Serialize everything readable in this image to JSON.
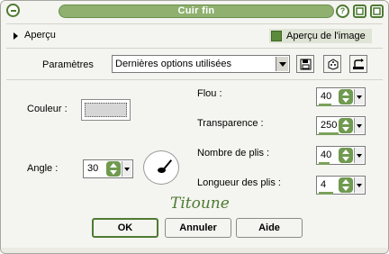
{
  "window": {
    "title": "Cuir fin",
    "help_glyph": "?"
  },
  "preview": {
    "toggle_label": "Aperçu",
    "image_checkbox_label": "Aperçu de l'image",
    "image_checked": true
  },
  "params": {
    "label": "Paramètres",
    "selected": "Dernières options utilisées"
  },
  "fields": {
    "couleur_label": "Couleur :",
    "couleur_value": "#d6d6d6",
    "angle_label": "Angle :",
    "angle_value": "30",
    "flou_label": "Flou :",
    "flou_value": "40",
    "transparence_label": "Transparence :",
    "transparence_value": "250",
    "plis_label": "Nombre de plis :",
    "plis_value": "40",
    "longueur_label": "Longueur des plis :",
    "longueur_value": "4"
  },
  "watermark": "Titoune",
  "buttons": {
    "ok": "OK",
    "annuler": "Annuler",
    "aide": "Aide"
  },
  "colors": {
    "accent": "#6f9a4f",
    "title_bar": "#8fb06f"
  }
}
